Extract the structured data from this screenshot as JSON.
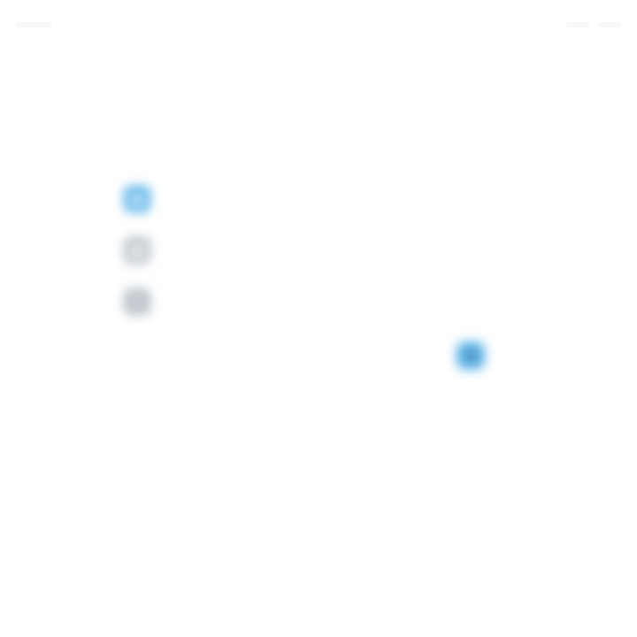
{
  "screen": {
    "title": "",
    "primary_color": "#5db4ea",
    "muted_color": "#b9bfc6"
  },
  "content": {
    "section_1": {
      "icon": "app-icon",
      "label": ""
    },
    "section_2": {
      "icon": "device-icon",
      "label": "",
      "sublabel": ""
    },
    "section_3": {
      "icon": "settings-icon",
      "label": "",
      "body": "",
      "note": ""
    }
  },
  "actions": {
    "primary": {
      "icon": "next-icon",
      "label": ""
    }
  }
}
